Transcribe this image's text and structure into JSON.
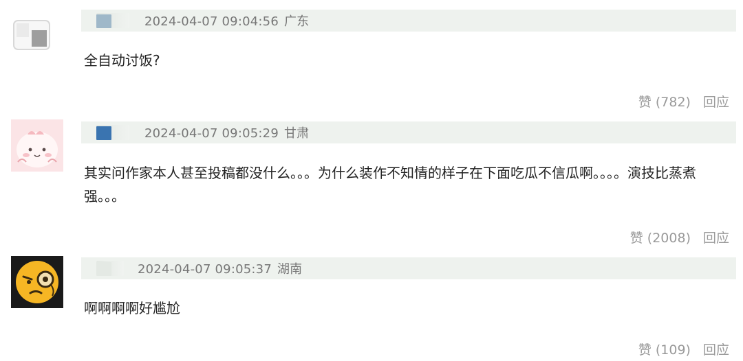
{
  "comments": [
    {
      "timestamp": "2024-04-07 09:04:56",
      "location": "广东",
      "text": "全自动讨饭?",
      "like_label": "赞 (782)",
      "reply_label": "回应",
      "name_chip_color": "#9fb8c9"
    },
    {
      "timestamp": "2024-04-07 09:05:29",
      "location": "甘肃",
      "text": "其实问作家本人甚至投稿都没什么。。。为什么装作不知情的样子在下面吃瓜不信瓜啊。。。。演技比蒸煮强。。。",
      "like_label": "赞 (2008)",
      "reply_label": "回应",
      "name_chip_color": "#3a74b0"
    },
    {
      "timestamp": "2024-04-07 09:05:37",
      "location": "湖南",
      "text": "啊啊啊啊好尴尬",
      "like_label": "赞 (109)",
      "reply_label": "回应",
      "name_chip_color": "#e4e9e4"
    }
  ],
  "colors": {
    "meta_bar": "#eef2ee",
    "meta_text": "#777777",
    "content_text": "#222222",
    "action_text": "#999999"
  }
}
